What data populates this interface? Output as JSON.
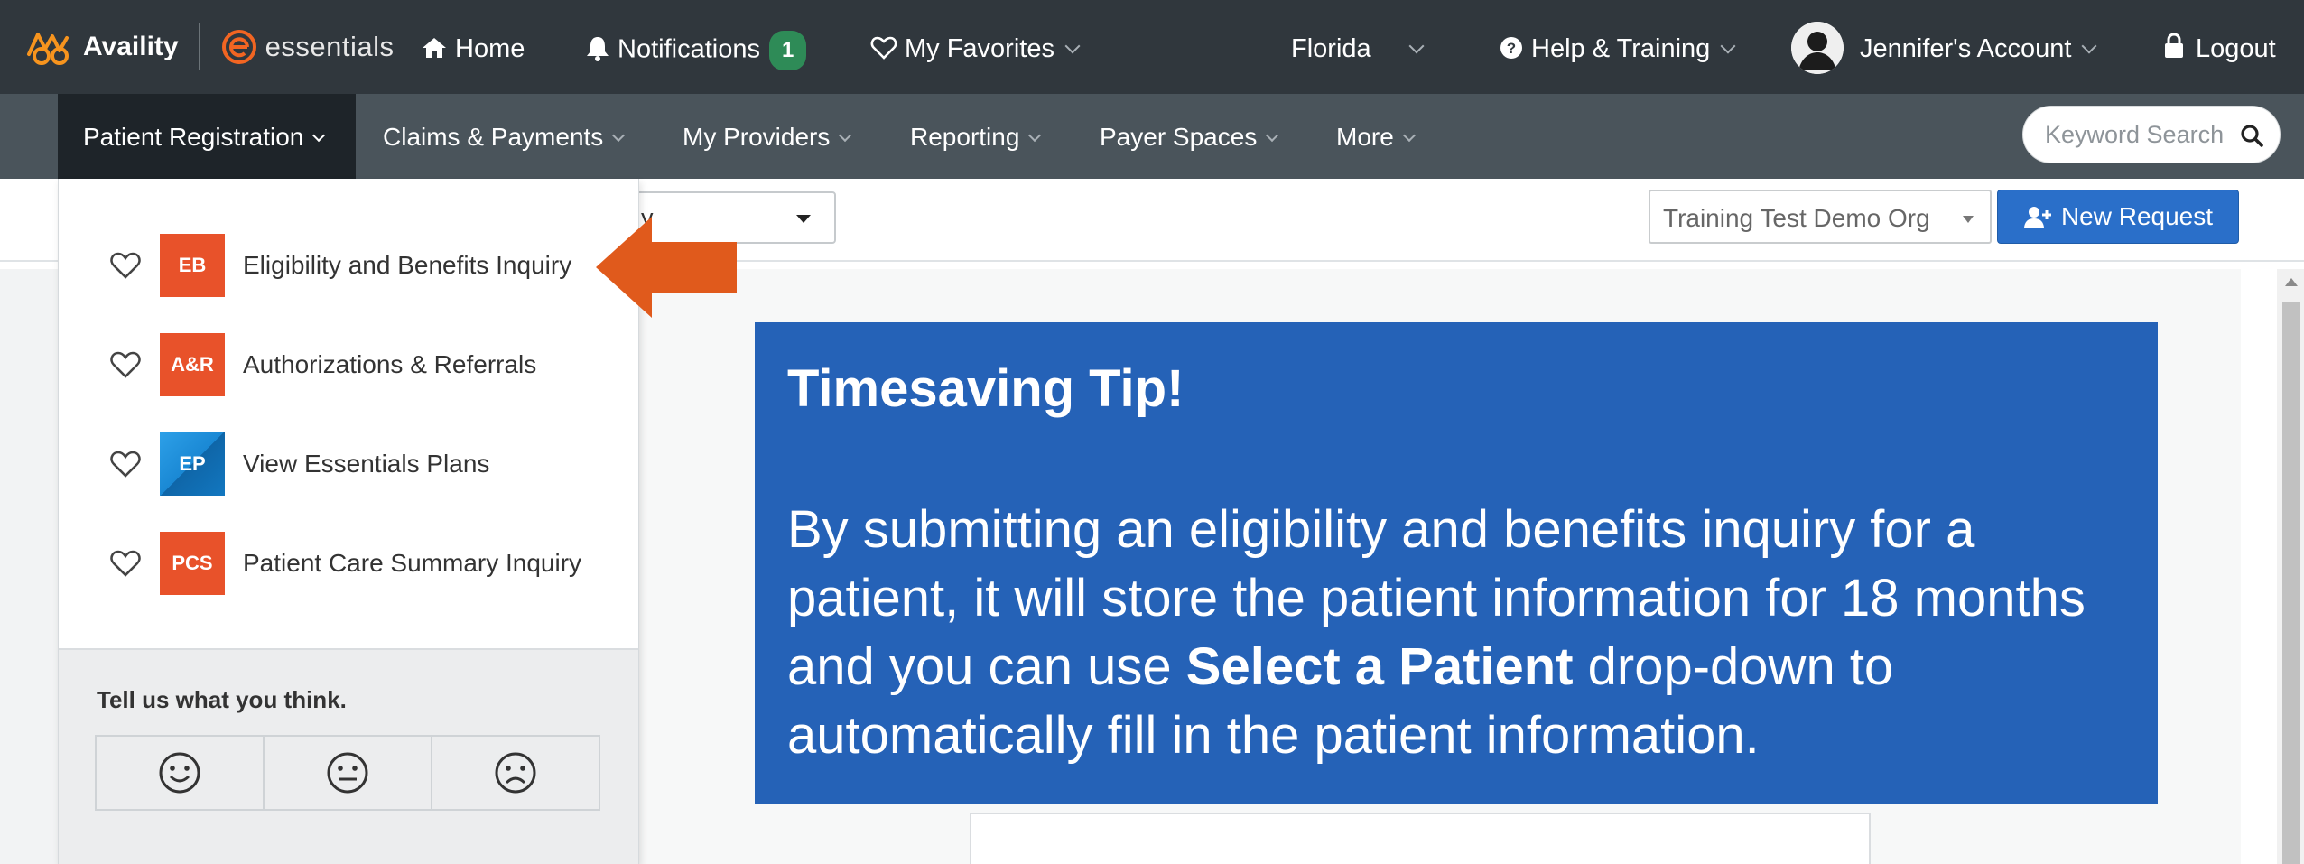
{
  "topbar": {
    "brand": "Availity",
    "essentials": "essentials",
    "home": "Home",
    "notifications": "Notifications",
    "notification_count": "1",
    "favorites": "My Favorites",
    "state": "Florida",
    "help": "Help & Training",
    "account": "Jennifer's Account",
    "logout": "Logout"
  },
  "subnav": {
    "items": [
      {
        "label": "Patient Registration"
      },
      {
        "label": "Claims & Payments"
      },
      {
        "label": "My Providers"
      },
      {
        "label": "Reporting"
      },
      {
        "label": "Payer Spaces"
      },
      {
        "label": "More"
      }
    ],
    "search_placeholder": "Keyword Search"
  },
  "toolbar": {
    "patient_select_partial": "y",
    "organization": "Training Test Demo Org",
    "new_request": "New Request"
  },
  "dropdown": {
    "items": [
      {
        "abbr": "EB",
        "label": "Eligibility and Benefits Inquiry",
        "color": "#e8522a"
      },
      {
        "abbr": "A&R",
        "label": "Authorizations & Referrals",
        "color": "#e8522a"
      },
      {
        "abbr": "EP",
        "label": "View Essentials Plans",
        "color": "#1a88d4"
      },
      {
        "abbr": "PCS",
        "label": "Patient Care Summary Inquiry",
        "color": "#e8522a"
      }
    ],
    "feedback_prompt": "Tell us what you think."
  },
  "tip": {
    "heading": "Timesaving Tip!",
    "body_pre": "By submitting an eligibility and benefits inquiry for a patient, it will store the patient information for 18 months and you can use ",
    "body_bold": "Select a Patient",
    "body_post": " drop-down to automatically fill in the patient information."
  },
  "colors": {
    "topbar": "#30373d",
    "subnav": "#4a545b",
    "accent_orange": "#e05a1c",
    "tip_blue": "#2562b7",
    "button_blue": "#2a6fc9"
  }
}
